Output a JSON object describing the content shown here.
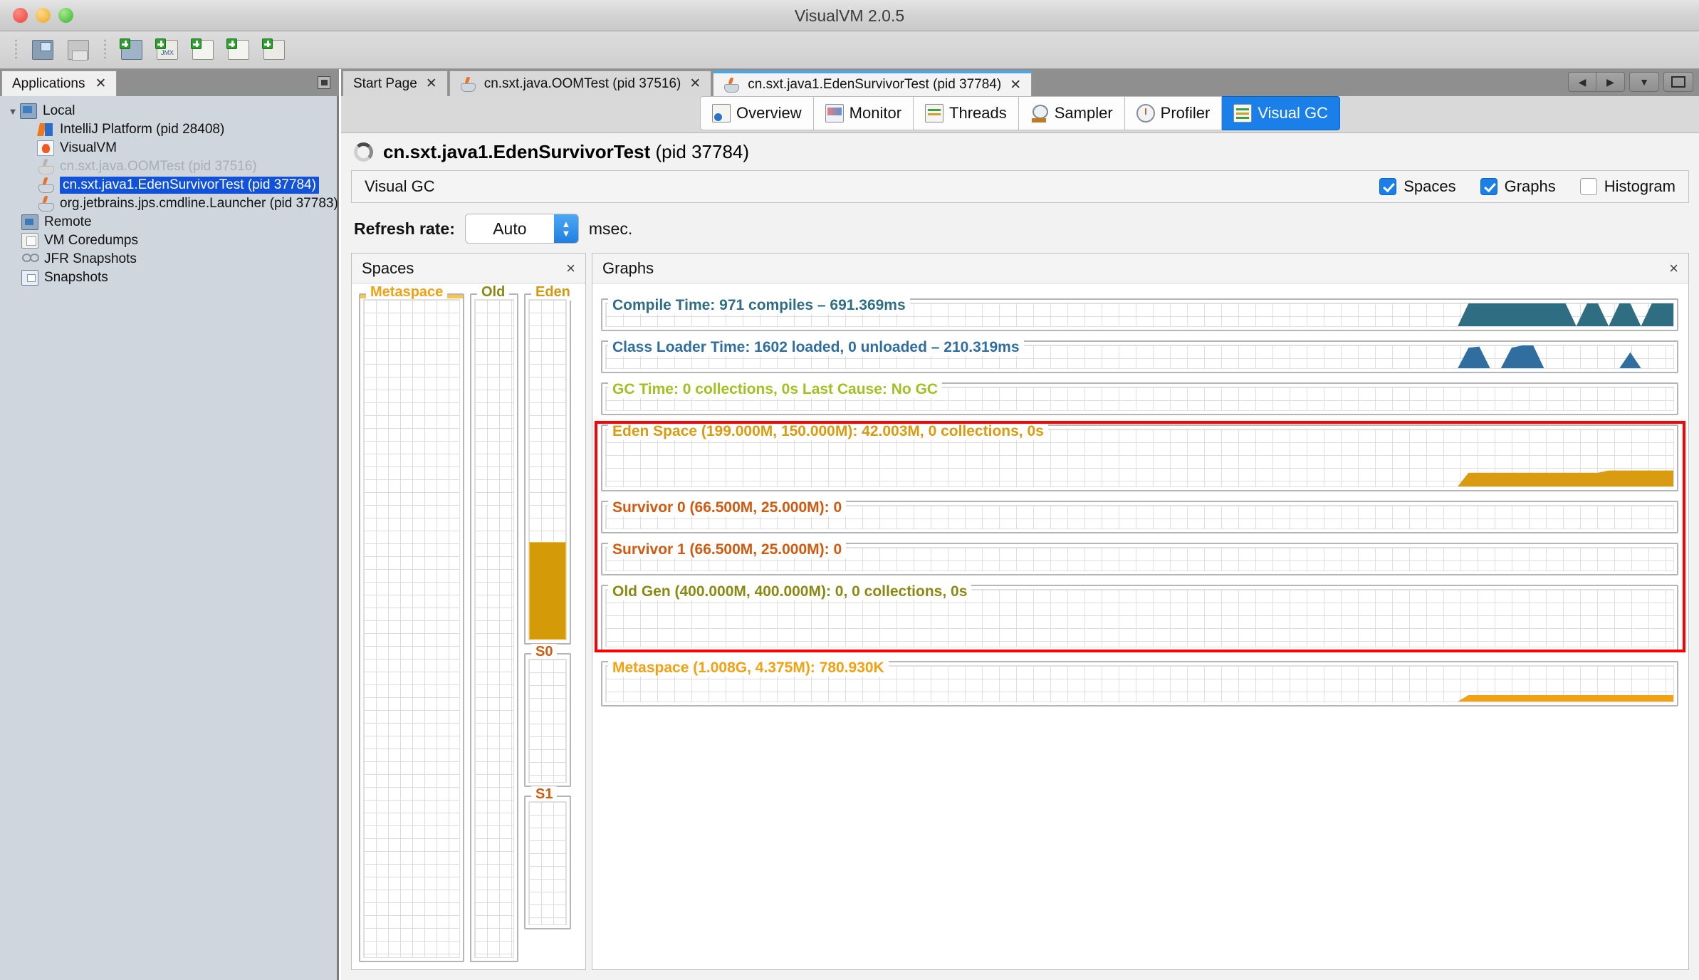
{
  "window": {
    "title": "VisualVM 2.0.5"
  },
  "traffic": {
    "close": "close-window",
    "minimize": "minimize-window",
    "zoom": "zoom-window"
  },
  "toolbar": {
    "buttons": [
      {
        "name": "open-file",
        "label": "Open File"
      },
      {
        "name": "save-file",
        "label": "Save"
      },
      {
        "name": "add-remote-host",
        "label": "Add Remote Host"
      },
      {
        "name": "add-jmx-connection",
        "label": "Add JMX Connection"
      },
      {
        "name": "load-heap-dump",
        "label": "Load Heap Dump"
      },
      {
        "name": "load-thread-dump",
        "label": "Load Thread Dump"
      },
      {
        "name": "add-application-snapshot",
        "label": "Add Application Snapshot"
      }
    ]
  },
  "sidebar": {
    "tab_label": "Applications",
    "tree": [
      {
        "label": "Local",
        "level": 0,
        "icon": "local-icon",
        "expanded": true,
        "state": "normal"
      },
      {
        "label": "IntelliJ Platform (pid 28408)",
        "level": 2,
        "icon": "intellij-icon",
        "state": "normal"
      },
      {
        "label": "VisualVM",
        "level": 2,
        "icon": "visualvm-icon",
        "state": "normal"
      },
      {
        "label": "cn.sxt.java.OOMTest (pid 37516)",
        "level": 2,
        "icon": "java-icon",
        "state": "dimmed"
      },
      {
        "label": "cn.sxt.java1.EdenSurvivorTest (pid 37784)",
        "level": 2,
        "icon": "java-icon",
        "state": "selected"
      },
      {
        "label": "org.jetbrains.jps.cmdline.Launcher (pid 37783)",
        "level": 2,
        "icon": "java-icon",
        "state": "normal"
      },
      {
        "label": "Remote",
        "level": 1,
        "icon": "remote-icon",
        "state": "normal"
      },
      {
        "label": "VM Coredumps",
        "level": 1,
        "icon": "coredump-icon",
        "state": "normal"
      },
      {
        "label": "JFR Snapshots",
        "level": 1,
        "icon": "jfr-icon",
        "state": "normal"
      },
      {
        "label": "Snapshots",
        "level": 1,
        "icon": "snapshots-icon",
        "state": "normal"
      }
    ]
  },
  "document_tabs": [
    {
      "label": "Start Page",
      "icon": null,
      "active": false,
      "closable": true
    },
    {
      "label": "cn.sxt.java.OOMTest (pid 37516)",
      "icon": "java-icon",
      "active": false,
      "closable": true
    },
    {
      "label": "cn.sxt.java1.EdenSurvivorTest (pid 37784)",
      "icon": "java-icon",
      "active": true,
      "closable": true
    }
  ],
  "tab_nav": {
    "prev": "◀",
    "next": "▶",
    "dropdown": "▼",
    "maximize": "maximize-icon"
  },
  "view_tabs": [
    {
      "label": "Overview",
      "icon": "overview-icon",
      "active": false
    },
    {
      "label": "Monitor",
      "icon": "monitor-icon",
      "active": false
    },
    {
      "label": "Threads",
      "icon": "threads-icon",
      "active": false
    },
    {
      "label": "Sampler",
      "icon": "sampler-icon",
      "active": false
    },
    {
      "label": "Profiler",
      "icon": "profiler-icon",
      "active": false
    },
    {
      "label": "Visual GC",
      "icon": "visualgc-icon",
      "active": true
    }
  ],
  "app_header": {
    "name": "cn.sxt.java1.EdenSurvivorTest",
    "pid": "(pid 37784)",
    "status_icon": "loading-spinner-icon"
  },
  "vgc_bar": {
    "title": "Visual GC",
    "checkboxes": [
      {
        "label": "Spaces",
        "checked": true
      },
      {
        "label": "Graphs",
        "checked": true
      },
      {
        "label": "Histogram",
        "checked": false
      }
    ]
  },
  "refresh": {
    "label": "Refresh rate:",
    "value": "Auto",
    "unit": "msec."
  },
  "spaces_panel": {
    "title": "Spaces",
    "close": "×",
    "columns": [
      {
        "name": "Metaspace",
        "color": "#f2a112",
        "fill_pct": 1
      },
      {
        "name": "Old",
        "color": "#8a8a12",
        "fill_pct": 0
      },
      {
        "name": "Eden",
        "color": "#d09a10",
        "fill_pct": 28
      },
      {
        "name": "S0",
        "color": "#d05a10",
        "fill_pct": 0
      },
      {
        "name": "S1",
        "color": "#d05a10",
        "fill_pct": 0
      }
    ]
  },
  "graphs_panel": {
    "title": "Graphs",
    "close": "×",
    "highlight_color": "#ff0000"
  },
  "chart_data": [
    {
      "type": "area",
      "name": "compile-time",
      "title": "Compile Time: 971 compiles – 691.369ms",
      "color": "#2f6e82",
      "metrics": {
        "compiles": 971,
        "total_ms": 691.369
      },
      "xlabel": "",
      "ylabel": "",
      "ylim": [
        0,
        100
      ],
      "grid": true,
      "values": [
        0,
        0,
        0,
        0,
        0,
        0,
        0,
        0,
        0,
        0,
        0,
        0,
        0,
        0,
        0,
        0,
        0,
        0,
        0,
        0,
        0,
        0,
        0,
        0,
        0,
        0,
        0,
        0,
        0,
        0,
        0,
        0,
        0,
        0,
        0,
        0,
        0,
        0,
        0,
        0,
        0,
        0,
        0,
        0,
        0,
        0,
        0,
        0,
        0,
        0,
        0,
        0,
        0,
        0,
        0,
        0,
        0,
        0,
        0,
        0,
        0,
        0,
        0,
        0,
        0,
        0,
        0,
        0,
        0,
        0,
        0,
        0,
        0,
        0,
        0,
        0,
        0,
        0,
        0,
        0,
        100,
        100,
        100,
        100,
        100,
        100,
        100,
        100,
        100,
        100,
        0,
        100,
        100,
        0,
        100,
        100,
        0,
        100,
        100,
        100
      ]
    },
    {
      "type": "area",
      "name": "class-loader-time",
      "title": "Class Loader Time: 1602 loaded, 0 unloaded – 210.319ms",
      "color": "#2f6e9e",
      "metrics": {
        "loaded": 1602,
        "unloaded": 0,
        "total_ms": 210.319
      },
      "xlabel": "",
      "ylabel": "",
      "ylim": [
        0,
        100
      ],
      "grid": true,
      "values": [
        0,
        0,
        0,
        0,
        0,
        0,
        0,
        0,
        0,
        0,
        0,
        0,
        0,
        0,
        0,
        0,
        0,
        0,
        0,
        0,
        0,
        0,
        0,
        0,
        0,
        0,
        0,
        0,
        0,
        0,
        0,
        0,
        0,
        0,
        0,
        0,
        0,
        0,
        0,
        0,
        0,
        0,
        0,
        0,
        0,
        0,
        0,
        0,
        0,
        0,
        0,
        0,
        0,
        0,
        0,
        0,
        0,
        0,
        0,
        0,
        0,
        0,
        0,
        0,
        0,
        0,
        0,
        0,
        0,
        0,
        0,
        0,
        0,
        0,
        0,
        0,
        0,
        0,
        0,
        0,
        90,
        95,
        0,
        0,
        90,
        100,
        100,
        0,
        0,
        0,
        0,
        0,
        0,
        0,
        0,
        70,
        0,
        0,
        0,
        0
      ]
    },
    {
      "type": "area",
      "name": "gc-time",
      "title": "GC Time: 0 collections, 0s Last Cause: No GC",
      "color": "#9fc220",
      "metrics": {
        "collections": 0,
        "total": "0s",
        "last_cause": "No GC"
      },
      "xlabel": "",
      "ylabel": "",
      "ylim": [
        0,
        100
      ],
      "grid": true,
      "values": [
        0,
        0,
        0,
        0,
        0,
        0,
        0,
        0,
        0,
        0,
        0,
        0,
        0,
        0,
        0,
        0,
        0,
        0,
        0,
        0,
        0,
        0,
        0,
        0,
        0,
        0,
        0,
        0,
        0,
        0,
        0,
        0,
        0,
        0,
        0,
        0,
        0,
        0,
        0,
        0,
        0,
        0,
        0,
        0,
        0,
        0,
        0,
        0,
        0,
        0,
        0,
        0,
        0,
        0,
        0,
        0,
        0,
        0,
        0,
        0,
        0,
        0,
        0,
        0,
        0,
        0,
        0,
        0,
        0,
        0,
        0,
        0,
        0,
        0,
        0,
        0,
        0,
        0,
        0,
        0,
        0,
        0,
        0,
        0,
        0,
        0,
        0,
        0,
        0,
        0,
        0,
        0,
        0,
        0,
        0,
        0,
        0,
        0,
        0,
        0
      ]
    },
    {
      "type": "area",
      "name": "eden-space",
      "title": "Eden Space (199.000M, 150.000M): 42.003M, 0 collections, 0s",
      "color": "#d99b10",
      "metrics": {
        "reserved": "199.000M",
        "committed": "150.000M",
        "used": "42.003M",
        "collections": 0,
        "gc_time": "0s"
      },
      "xlabel": "",
      "ylabel": "",
      "ylim": [
        0,
        100
      ],
      "grid": true,
      "values": [
        0,
        0,
        0,
        0,
        0,
        0,
        0,
        0,
        0,
        0,
        0,
        0,
        0,
        0,
        0,
        0,
        0,
        0,
        0,
        0,
        0,
        0,
        0,
        0,
        0,
        0,
        0,
        0,
        0,
        0,
        0,
        0,
        0,
        0,
        0,
        0,
        0,
        0,
        0,
        0,
        0,
        0,
        0,
        0,
        0,
        0,
        0,
        0,
        0,
        0,
        0,
        0,
        0,
        0,
        0,
        0,
        0,
        0,
        0,
        0,
        0,
        0,
        0,
        0,
        0,
        0,
        0,
        0,
        0,
        0,
        0,
        0,
        0,
        0,
        0,
        0,
        0,
        0,
        0,
        0,
        24,
        24,
        24,
        24,
        24,
        24,
        24,
        24,
        24,
        24,
        24,
        24,
        24,
        28,
        28,
        28,
        28,
        28,
        28,
        28
      ]
    },
    {
      "type": "area",
      "name": "survivor-0",
      "title": "Survivor 0 (66.500M, 25.000M): 0",
      "color": "#d05a10",
      "metrics": {
        "reserved": "66.500M",
        "committed": "25.000M",
        "used": "0"
      },
      "xlabel": "",
      "ylabel": "",
      "ylim": [
        0,
        100
      ],
      "grid": true,
      "values": [
        0,
        0,
        0,
        0,
        0,
        0,
        0,
        0,
        0,
        0,
        0,
        0,
        0,
        0,
        0,
        0,
        0,
        0,
        0,
        0,
        0,
        0,
        0,
        0,
        0,
        0,
        0,
        0,
        0,
        0,
        0,
        0,
        0,
        0,
        0,
        0,
        0,
        0,
        0,
        0,
        0,
        0,
        0,
        0,
        0,
        0,
        0,
        0,
        0,
        0
      ]
    },
    {
      "type": "area",
      "name": "survivor-1",
      "title": "Survivor 1 (66.500M, 25.000M): 0",
      "color": "#d05a10",
      "metrics": {
        "reserved": "66.500M",
        "committed": "25.000M",
        "used": "0"
      },
      "xlabel": "",
      "ylabel": "",
      "ylim": [
        0,
        100
      ],
      "grid": true,
      "values": [
        0,
        0,
        0,
        0,
        0,
        0,
        0,
        0,
        0,
        0,
        0,
        0,
        0,
        0,
        0,
        0,
        0,
        0,
        0,
        0,
        0,
        0,
        0,
        0,
        0,
        0,
        0,
        0,
        0,
        0,
        0,
        0,
        0,
        0,
        0,
        0,
        0,
        0,
        0,
        0,
        0,
        0,
        0,
        0,
        0,
        0,
        0,
        0,
        0,
        0
      ]
    },
    {
      "type": "area",
      "name": "old-gen",
      "title": "Old Gen (400.000M, 400.000M): 0, 0 collections, 0s",
      "color": "#8a8a12",
      "metrics": {
        "reserved": "400.000M",
        "committed": "400.000M",
        "used": "0",
        "collections": 0,
        "gc_time": "0s"
      },
      "xlabel": "",
      "ylabel": "",
      "ylim": [
        0,
        100
      ],
      "grid": true,
      "values": [
        0,
        0,
        0,
        0,
        0,
        0,
        0,
        0,
        0,
        0,
        0,
        0,
        0,
        0,
        0,
        0,
        0,
        0,
        0,
        0,
        0,
        0,
        0,
        0,
        0,
        0,
        0,
        0,
        0,
        0,
        0,
        0,
        0,
        0,
        0,
        0,
        0,
        0,
        0,
        0,
        0,
        0,
        0,
        0,
        0,
        0,
        0,
        0,
        0,
        0
      ]
    },
    {
      "type": "area",
      "name": "metaspace",
      "title": "Metaspace (1.008G, 4.375M): 780.930K",
      "color": "#f2a112",
      "metrics": {
        "reserved": "1.008G",
        "committed": "4.375M",
        "used": "780.930K"
      },
      "xlabel": "",
      "ylabel": "",
      "ylim": [
        0,
        100
      ],
      "grid": true,
      "values": [
        0,
        0,
        0,
        0,
        0,
        0,
        0,
        0,
        0,
        0,
        0,
        0,
        0,
        0,
        0,
        0,
        0,
        0,
        0,
        0,
        0,
        0,
        0,
        0,
        0,
        0,
        0,
        0,
        0,
        0,
        0,
        0,
        0,
        0,
        0,
        0,
        0,
        0,
        0,
        0,
        0,
        0,
        0,
        0,
        0,
        0,
        0,
        0,
        0,
        0,
        0,
        0,
        0,
        0,
        0,
        0,
        0,
        0,
        0,
        0,
        0,
        0,
        0,
        0,
        0,
        0,
        0,
        0,
        0,
        0,
        0,
        0,
        0,
        0,
        0,
        0,
        0,
        0,
        0,
        0,
        18,
        18,
        18,
        18,
        18,
        18,
        18,
        18,
        18,
        18,
        18,
        18,
        18,
        18,
        18,
        18,
        18,
        18,
        18,
        18
      ]
    }
  ]
}
